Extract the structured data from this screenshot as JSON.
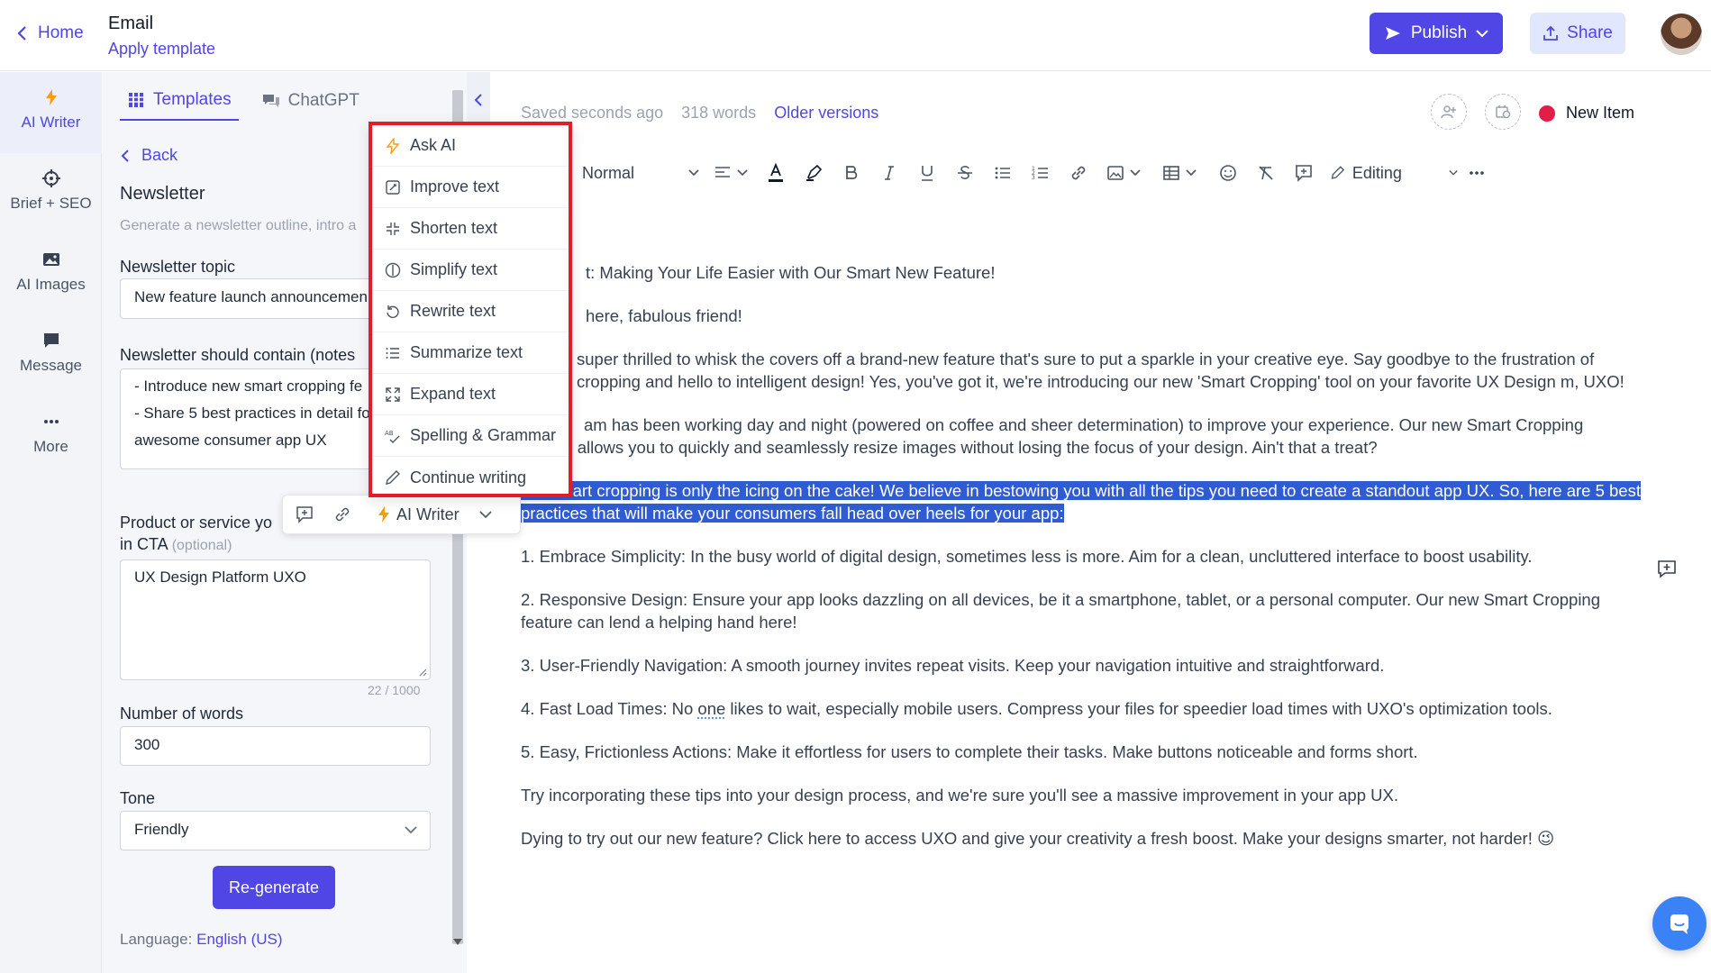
{
  "header": {
    "home_label": "Home",
    "doc_title": "Email",
    "apply_template": "Apply template",
    "publish_label": "Publish",
    "share_label": "Share"
  },
  "rail": {
    "items": [
      {
        "label": "AI Writer",
        "icon": "bolt-icon",
        "active": true
      },
      {
        "label": "Brief + SEO",
        "icon": "target-icon"
      },
      {
        "label": "AI Images",
        "icon": "image-icon"
      },
      {
        "label": "Message",
        "icon": "message-icon"
      },
      {
        "label": "More",
        "icon": "more-icon"
      }
    ]
  },
  "panel": {
    "tabs": [
      {
        "label": "Templates",
        "active": true
      },
      {
        "label": "ChatGPT",
        "active": false
      }
    ],
    "back_label": "Back",
    "heading": "Newsletter",
    "description": "Generate a newsletter outline, intro a",
    "fields": {
      "topic_label": "Newsletter topic",
      "topic_value": "New feature launch announcemen",
      "contain_label": "Newsletter should contain (notes",
      "contain_value": "- Introduce new smart cropping fe\n- Share 5 best practices in detail fo\nawesome consumer app UX",
      "product_label_1": "Product or service yo",
      "product_label_2": "in CTA",
      "optional": "(optional)",
      "product_value": "UX Design Platform UXO",
      "counter": "22 / 1000",
      "words_label": "Number of words",
      "words_value": "300",
      "tone_label": "Tone",
      "tone_value": "Friendly"
    },
    "regenerate_label": "Re-generate",
    "language_prefix": "Language:",
    "language_value": "English (US)"
  },
  "editor": {
    "saved": "Saved seconds ago",
    "words": "318 words",
    "older_versions": "Older versions",
    "new_item": "New Item",
    "format_select": "Normal",
    "editing_label": "Editing",
    "paragraphs": {
      "subject": "t: Making Your Life Easier with Our Smart New Feature!",
      "greeting": "here, fabulous friend!",
      "p1": "super thrilled to whisk the covers off a brand-new feature that's sure to put a sparkle in your creative eye. Say goodbye to the frustration of cropping and hello to intelligent design! Yes, you've got it, we're introducing our new 'Smart Cropping' tool on your favorite UX Design m, UXO!",
      "p2a": "am has been working day and night (powered on coffee and sheer determination) to improve your experience. Our new Smart Cropping",
      "p2b": "feature allows you to quickly and seamlessly resize images without losing the focus of your design. Ain't that a treat?",
      "selected": "But smart cropping is only the icing on the cake! We believe in bestowing you with all the tips you need to create a standout app UX. So, here are 5 best practices that will make your consumers fall head over heels for your app:",
      "l1": "1. Embrace Simplicity: In the busy world of digital design, sometimes less is more. Aim for a clean, uncluttered interface to boost usability.",
      "l2": "2. Responsive Design: Ensure your app looks dazzling on all devices, be it a smartphone, tablet, or a personal computer. Our new Smart Cropping feature can lend a helping hand here!",
      "l3": "3. User-Friendly Navigation: A smooth journey invites repeat visits. Keep your navigation intuitive and straightforward.",
      "l4_pre": "4. Fast Load Times: No ",
      "l4_wavy": "one",
      "l4_post": " likes to wait, especially mobile users. Compress your files for speedier load times with UXO's optimization tools.",
      "l5": "5. Easy, Frictionless Actions: Make it effortless for users to complete their tasks. Make buttons noticeable and forms short.",
      "closing": "Try incorporating these tips into your design process, and we're sure you'll see a massive improvement in your app UX.",
      "cta": "Dying to try out our new feature? Click here to access UXO and give your creativity a fresh boost. Make your designs smarter, not harder! 😉"
    }
  },
  "ai_bar": {
    "writer_label": "AI Writer"
  },
  "ai_menu": {
    "items": [
      {
        "label": "Ask AI",
        "icon": "bolt-icon"
      },
      {
        "label": "Improve text",
        "icon": "improve-icon"
      },
      {
        "label": "Shorten text",
        "icon": "shrink-icon"
      },
      {
        "label": "Simplify text",
        "icon": "simplify-icon"
      },
      {
        "label": "Rewrite text",
        "icon": "rewrite-icon"
      },
      {
        "label": "Summarize text",
        "icon": "list-icon"
      },
      {
        "label": "Expand text",
        "icon": "expand-icon"
      },
      {
        "label": "Spelling & Grammar",
        "icon": "spellcheck-icon"
      },
      {
        "label": "Continue writing",
        "icon": "pen-icon"
      }
    ]
  },
  "colors": {
    "accent": "#4f46e5",
    "menu_border": "#e11d2a",
    "selection": "#2f5bd3",
    "status_dot": "#e11d48"
  }
}
